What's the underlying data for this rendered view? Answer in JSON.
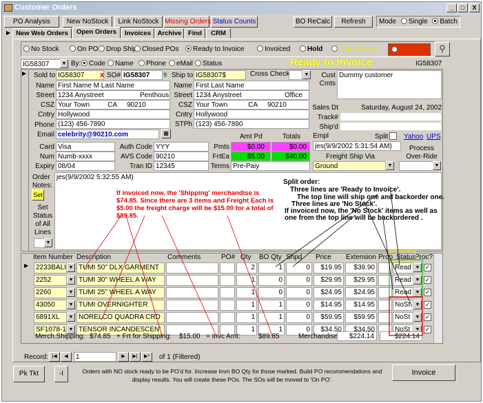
{
  "window": {
    "title": "Customer Orders",
    "controls": [
      "_",
      "□",
      "X"
    ]
  },
  "toolbar": {
    "po_analysis": "PO Analysis",
    "new_nostock": "New NoStock",
    "link_nostock": "Link NoStock",
    "missing_orders": "Missing Orders",
    "status_counts": "Status Counts",
    "bo_recalc": "BO ReCalc",
    "refresh": "Refresh",
    "mode_label": "Mode",
    "mode_single": "Single",
    "mode_batch": "Batch"
  },
  "tabs": [
    "New Web Orders",
    "Open Orders",
    "Invoices",
    "Archive",
    "Find",
    "CRM"
  ],
  "filters": {
    "options": [
      "No Stock",
      "On PO",
      "Drop Ship",
      "Closed POs",
      "Ready to Invoice",
      "Invoiced",
      "Hold",
      "Trash/Bogus"
    ],
    "selected": "Ready to Invoice",
    "status_banner": "Ready to Invoice"
  },
  "search": {
    "order_id": "IG58307",
    "by_label": "By:",
    "by_options": [
      "Code",
      "Name",
      "Phone",
      "eMail",
      "Status"
    ],
    "by_selected": "Code",
    "right_id": "IG58307"
  },
  "sold_to": {
    "label": "Sold to",
    "code": "IG58307",
    "so_label": "SO#",
    "so": "IG58307",
    "name_label": "Name",
    "name": "First Name M Last Name",
    "street_label": "Street",
    "street": "1234 Anystreet",
    "street2": "Penthous",
    "csz_label": "CSZ",
    "city": "Your Town",
    "state": "CA",
    "zip": "90210",
    "cntry_label": "Cntry",
    "cntry": "Hollywood",
    "phone_label": "Phone",
    "phone": "(123) 456-7890",
    "email_label": "Email",
    "email": "celebrity@90210.com"
  },
  "ship_to": {
    "label": "Ship to",
    "code": "IG58307$",
    "cross_check": "Cross Check",
    "name_label": "Name",
    "name": "First Last Name",
    "street_label": "Street",
    "street": "1234 Anystreet",
    "street2": "Office",
    "csz_label": "CSZ",
    "city": "Your Town",
    "state": "CA",
    "zip": "90210",
    "cntry_label": "Cntry",
    "cntry": "Hollywood",
    "stph_label": "STPh",
    "stph": "(123) 456-7890"
  },
  "cust": {
    "cust_label": "Cust",
    "cmts_label": "Cmts",
    "cust": "Dummy customer",
    "sales_dt_label": "Sales Dt",
    "sales_dt": "Saturday, August 24, 2002",
    "track_label": "Track#",
    "shipd_label": "Ship'd",
    "empl_label": "Empl",
    "split_label": "Split",
    "yahoo": "Yahoo",
    "ups": "UPS"
  },
  "payment": {
    "card_label": "Card",
    "card": "Visa",
    "num_label": "Num",
    "num": "Numb-xxxx",
    "expiry_label": "Expiry",
    "expiry": "08/04",
    "auth_label": "Auth Code",
    "auth": "YYY",
    "avs_label": "AVS Code",
    "avs": "90210",
    "tran_label": "Tran ID",
    "tran": "12345",
    "amt_pd_label": "Amt Pd",
    "totals_label": "Totals",
    "pmts_label": "Pmts",
    "pmts_amt": "$0.00",
    "pmts_total": "$0.00",
    "frtea_label": "FrtEa",
    "frtea_amt": "$5.00",
    "frtea_total": "$40.00",
    "terms_label": "Terms",
    "terms": "Pre-Paiy",
    "empl_entry": "jes(9/9/2002 5:31:54 AM)",
    "freight_label": "Freight Ship Via",
    "freight": "Ground",
    "process_label": "Process Over-Ride"
  },
  "notes": {
    "order_notes_label": "Order Notes:",
    "set_btn": "Set",
    "set_status_label": "Set Status of All Lines",
    "text": "jes(9/9/2002 5:32:55 AM)",
    "annotation_red": "If invoiced now, the 'Shipping' merchandise is $74.85. Since there are 3 items and Freight Each is $5.00 the freight charge will be $15.00 for a total of $89.85.",
    "split_title": "Split order:",
    "split_lines": [
      "Three lines are 'Ready to Invoice'.",
      "The top line will ship one and backorder one.",
      "Three lines are 'No Stock'.",
      "If invoiced now, the 'No Stock' items as well as",
      "one from the top line will be backordered ."
    ]
  },
  "grid": {
    "headers": [
      "Item Number",
      "Description",
      "Comments",
      "PO#",
      "Qty",
      "BO Qty",
      "Shpd",
      "Price",
      "Extension",
      "Prob",
      "Status",
      "Proc?"
    ],
    "rows": [
      {
        "item": "2233BALIS",
        "desc": "TUMI 50\" DLX GARMENT",
        "qty": "2",
        "bo": "1",
        "shpd": "0",
        "price": "$19.95",
        "ext": "$39.90",
        "status": "Read"
      },
      {
        "item": "2252",
        "desc": "TUMI 30\" WHEEL A WAY",
        "qty": "1",
        "bo": "0",
        "shpd": "0",
        "price": "$29.95",
        "ext": "$29.95",
        "status": "Read"
      },
      {
        "item": "2260",
        "desc": "TUMI 25\" WHEEL A WAY",
        "qty": "1",
        "bo": "0",
        "shpd": "0",
        "price": "$24.95",
        "ext": "$24.95",
        "status": "Read"
      },
      {
        "item": "43050",
        "desc": "TUMI OVERNIGHTER",
        "qty": "1",
        "bo": "1",
        "shpd": "0",
        "price": "$14.95",
        "ext": "$14.95",
        "status": "NoSt"
      },
      {
        "item": "6891XL",
        "desc": "NORELCO QUADRA CRD",
        "qty": "1",
        "bo": "1",
        "shpd": "0",
        "price": "$59.95",
        "ext": "$59.95",
        "status": "NoSt"
      },
      {
        "item": "SF1078-12",
        "desc": "TENSOR INCANDESCEN'",
        "qty": "1",
        "bo": "1",
        "shpd": "0",
        "price": "$34.50",
        "ext": "$34.50",
        "status": "NoSt"
      }
    ]
  },
  "totals": {
    "merch_ship_label": "Merch.Shipping:",
    "merch_ship": "$74.85",
    "frt_label": "+ Frt for Shipping:",
    "frt": "$15.00",
    "invc_label": "= Invc Amt:",
    "invc": "$89.85",
    "merch_label": "Merchandise:",
    "merch": "$224.14",
    "merch2": "$224.14"
  },
  "record": {
    "label": "Record:",
    "current": "1",
    "of_text": "of  1 (Filtered)"
  },
  "footer": {
    "pk_tkt": "Pk Tkt",
    "i_btn": "-I",
    "message": "Orders with NO stock ready to be PO'd for.  Increase Invn BO Qty for those marked. Build PO recommendations and display results. You will create these POs. The SOs will be moved to 'On PO'.",
    "invoice": "Invoice"
  },
  "colors": {
    "accent_red": "#e00000",
    "pmts_bg": "#ff40ff",
    "frt_bg": "#00e000",
    "banner": "#ffff40",
    "field_yellow": "#fffec0"
  }
}
